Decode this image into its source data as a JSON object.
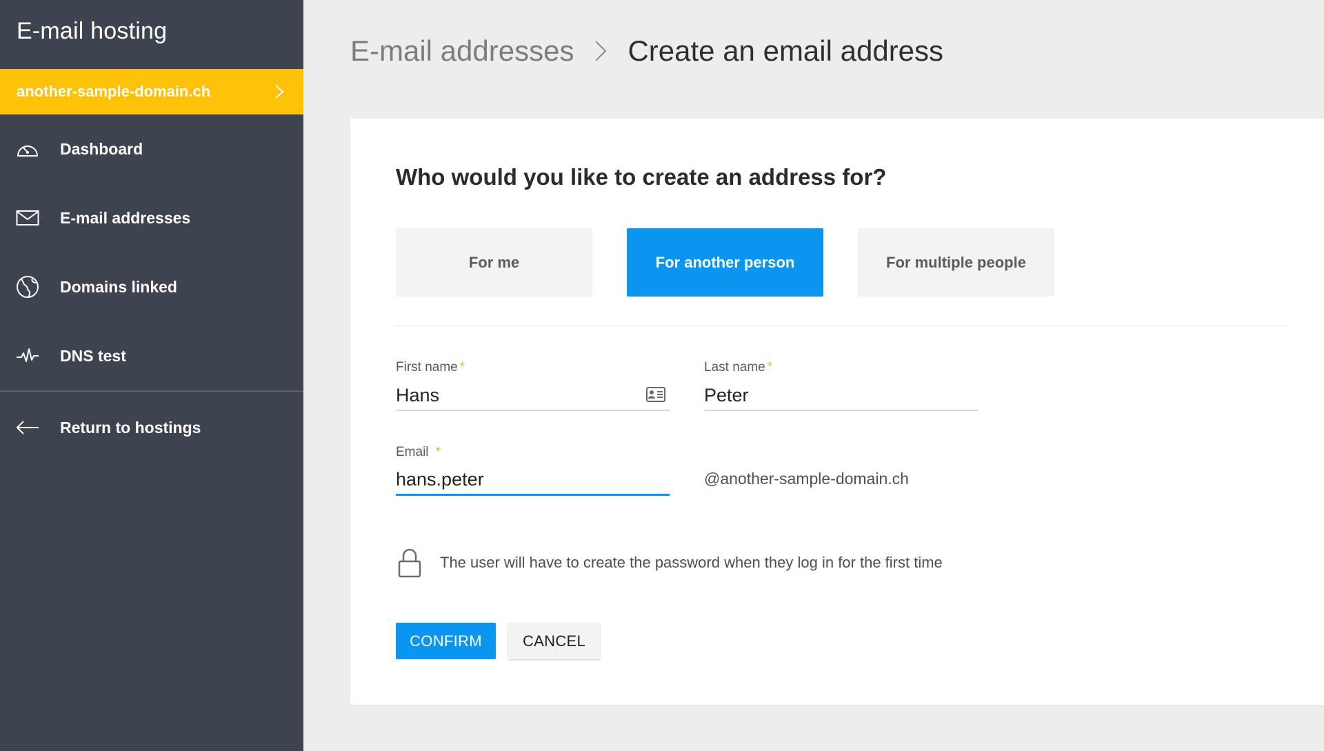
{
  "sidebar": {
    "app_title": "E-mail hosting",
    "domain": "another-sample-domain.ch",
    "items": [
      {
        "label": "Dashboard",
        "icon": "gauge-icon"
      },
      {
        "label": "E-mail addresses",
        "icon": "envelope-icon"
      },
      {
        "label": "Domains linked",
        "icon": "globe-icon"
      },
      {
        "label": "DNS test",
        "icon": "pulse-icon"
      }
    ],
    "return_label": "Return to hostings"
  },
  "breadcrumb": {
    "parent": "E-mail addresses",
    "current": "Create an email address"
  },
  "form": {
    "question": "Who would you like to create an address for?",
    "choices": [
      {
        "label": "For me",
        "selected": false
      },
      {
        "label": "For another person",
        "selected": true
      },
      {
        "label": "For multiple people",
        "selected": false
      }
    ],
    "first_name": {
      "label": "First name",
      "required_mark": "*",
      "value": "Hans"
    },
    "last_name": {
      "label": "Last name",
      "required_mark": "*",
      "value": "Peter"
    },
    "email": {
      "label": "Email",
      "required_mark": "*",
      "value": "hans.peter"
    },
    "domain_suffix": "@another-sample-domain.ch",
    "password_note": "The user will have to create the password when they log in for the first time",
    "confirm_label": "CONFIRM",
    "cancel_label": "CANCEL"
  },
  "colors": {
    "sidebar_bg": "#3e4350",
    "accent_yellow": "#ffc107",
    "primary_blue": "#0a96f0",
    "page_bg": "#eeedee"
  }
}
